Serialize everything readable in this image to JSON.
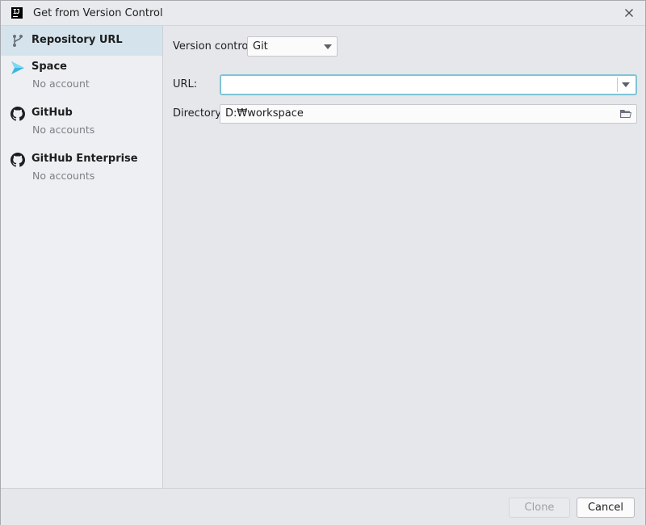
{
  "window": {
    "title": "Get from Version Control",
    "app_icon_text": "IJ"
  },
  "sidebar": {
    "items": [
      {
        "label": "Repository URL",
        "sub": "",
        "icon": "branch-icon",
        "selected": true
      },
      {
        "label": "Space",
        "sub": "No account",
        "icon": "space-icon",
        "selected": false
      },
      {
        "label": "GitHub",
        "sub": "No accounts",
        "icon": "github-icon",
        "selected": false
      },
      {
        "label": "GitHub Enterprise",
        "sub": "No accounts",
        "icon": "github-icon",
        "selected": false
      }
    ]
  },
  "form": {
    "version_control_label": "Version control:",
    "version_control_value": "Git",
    "url_label": "URL:",
    "url_value": "",
    "directory_label": "Directory:",
    "directory_value": "D:₩workspace"
  },
  "footer": {
    "clone_label": "Clone",
    "cancel_label": "Cancel",
    "clone_enabled": false
  },
  "colors": {
    "accent_focus": "#7fc4d6",
    "selection_bg": "#d5e4ec",
    "space_icon": "#3ab8e0"
  }
}
